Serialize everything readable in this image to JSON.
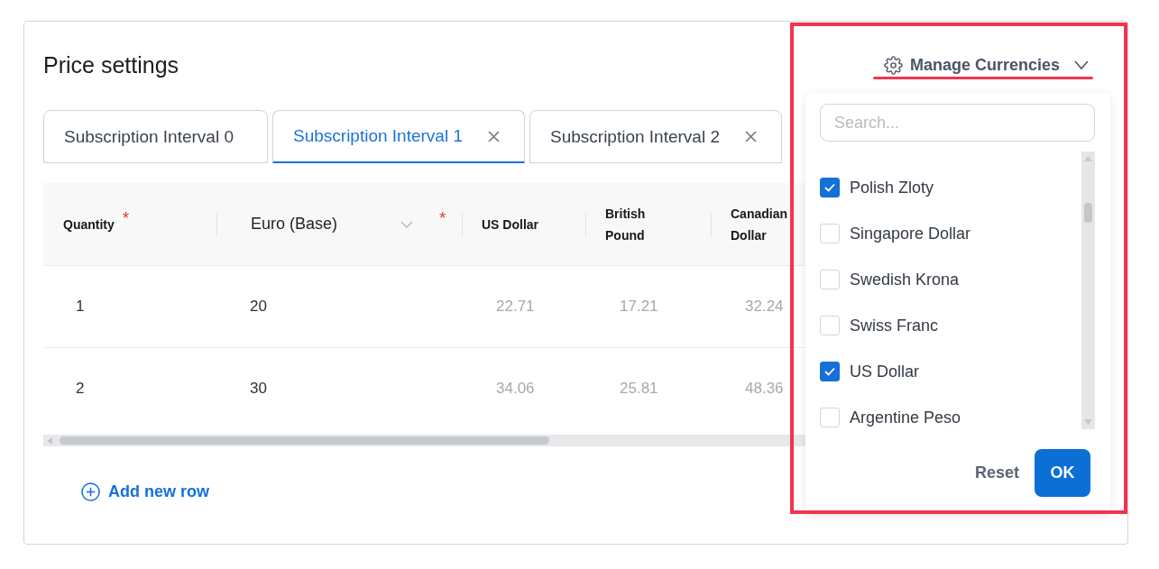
{
  "card": {
    "title": "Price settings"
  },
  "manage_currencies": {
    "label": "Manage Currencies",
    "expanded": true
  },
  "tabs": [
    {
      "label": "Subscription Interval 0",
      "selected": false,
      "closable": false
    },
    {
      "label": "Subscription Interval 1",
      "selected": true,
      "closable": true
    },
    {
      "label": "Subscription Interval 2",
      "selected": false,
      "closable": true
    }
  ],
  "table": {
    "columns": [
      {
        "label": "Quantity",
        "kind": "quantity",
        "required_mark": "*"
      },
      {
        "label": "Euro (Base)",
        "kind": "base",
        "required_mark": "*"
      },
      {
        "label": "US Dollar",
        "kind": "converted"
      },
      {
        "label": "British Pound",
        "kind": "converted"
      },
      {
        "label": "Canadian Dollar",
        "kind": "converted"
      }
    ],
    "rows": [
      {
        "cells": [
          "1",
          "20",
          "22.71",
          "17.21",
          "32.24"
        ]
      },
      {
        "cells": [
          "2",
          "30",
          "34.06",
          "25.81",
          "48.36"
        ]
      }
    ]
  },
  "add_row": {
    "label": "Add new row"
  },
  "currency_menu": {
    "search": {
      "placeholder": "Search..."
    },
    "items": [
      {
        "label": "Polish Zloty",
        "checked": true
      },
      {
        "label": "Singapore Dollar",
        "checked": false
      },
      {
        "label": "Swedish Krona",
        "checked": false
      },
      {
        "label": "Swiss Franc",
        "checked": false
      },
      {
        "label": "US Dollar",
        "checked": true
      },
      {
        "label": "Argentine Peso",
        "checked": false
      }
    ],
    "reset": "Reset",
    "ok": "OK"
  },
  "highlight": {
    "frame": true,
    "underline": true
  }
}
